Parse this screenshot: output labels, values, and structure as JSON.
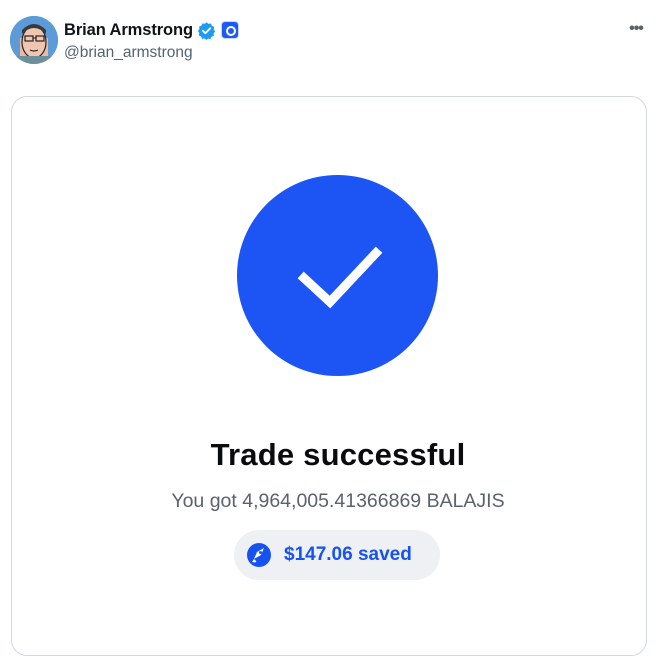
{
  "post": {
    "author_name": "Brian Armstrong",
    "author_handle": "@brian_armstrong",
    "more_label": "•••"
  },
  "card": {
    "title": "Trade successful",
    "subtitle": "You got 4,964,005.41366869 BALAJIS",
    "saved_label": "$147.06 saved"
  },
  "colors": {
    "accent": "#1d55f5",
    "verified": "#1d9bf0",
    "saved_text": "#1652f0",
    "pill_bg": "#eef0f3"
  },
  "icons": {
    "avatar": "avatar",
    "verified": "verified-badge-icon",
    "affiliate": "coinbase-affiliate-icon",
    "more": "more-options-icon",
    "checkmark": "checkmark-icon",
    "savings": "rocket-icon"
  }
}
